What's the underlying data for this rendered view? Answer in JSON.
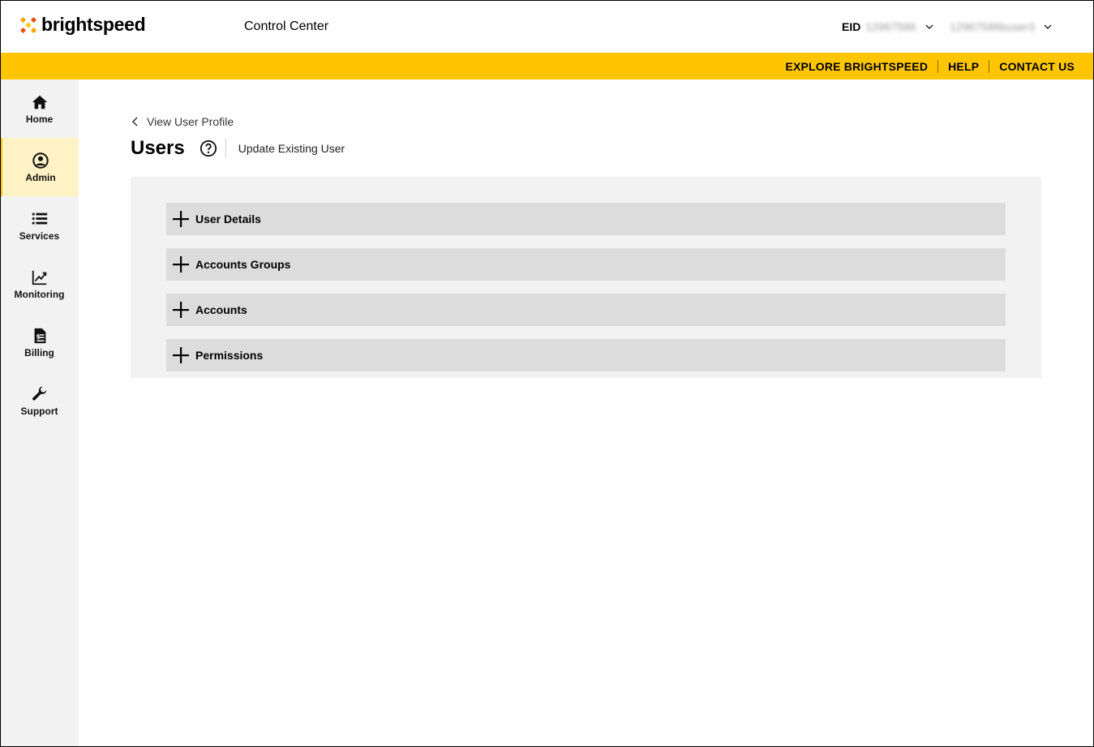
{
  "header": {
    "logo_text": "brightspeed",
    "app_title": "Control Center",
    "eid_label": "EID",
    "eid_value": "12967586",
    "user_name": "12967586buser3"
  },
  "topbar": {
    "links": [
      "EXPLORE BRIGHTSPEED",
      "HELP",
      "CONTACT US"
    ]
  },
  "sidebar": {
    "items": [
      {
        "label": "Home",
        "icon": "home-icon"
      },
      {
        "label": "Admin",
        "icon": "user-circle-icon",
        "active": true
      },
      {
        "label": "Services",
        "icon": "list-icon"
      },
      {
        "label": "Monitoring",
        "icon": "chart-icon"
      },
      {
        "label": "Billing",
        "icon": "invoice-icon"
      },
      {
        "label": "Support",
        "icon": "wrench-icon"
      }
    ]
  },
  "main": {
    "back_label": "View User Profile",
    "title": "Users",
    "subtitle": "Update Existing User",
    "sections": [
      {
        "label": "User Details"
      },
      {
        "label": "Accounts Groups"
      },
      {
        "label": "Accounts"
      },
      {
        "label": "Permissions"
      }
    ]
  },
  "colors": {
    "brand_yellow": "#ffc600",
    "active_nav_bg": "#fff2c4",
    "sidebar_bg": "#f2f2f2",
    "accordion_bg": "#dcdcdc"
  }
}
